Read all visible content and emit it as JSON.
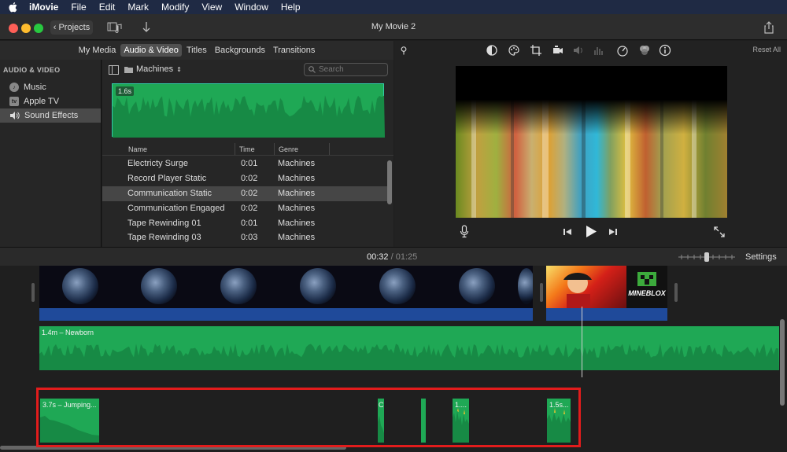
{
  "menubar": {
    "app": "iMovie",
    "items": [
      "File",
      "Edit",
      "Mark",
      "Modify",
      "View",
      "Window",
      "Help"
    ]
  },
  "window": {
    "title": "My Movie 2",
    "projects_label": "Projects"
  },
  "tabs": [
    {
      "label": "My Media",
      "active": false
    },
    {
      "label": "Audio & Video",
      "active": true
    },
    {
      "label": "Titles",
      "active": false
    },
    {
      "label": "Backgrounds",
      "active": false
    },
    {
      "label": "Transitions",
      "active": false
    }
  ],
  "sidebar": {
    "heading": "AUDIO & VIDEO",
    "items": [
      {
        "label": "Music",
        "icon": "music-icon",
        "selected": false
      },
      {
        "label": "Apple TV",
        "icon": "appletv-icon",
        "selected": false
      },
      {
        "label": "Sound Effects",
        "icon": "speaker-icon",
        "selected": true
      }
    ]
  },
  "browser": {
    "category": "Machines",
    "search_placeholder": "Search",
    "preview_duration": "1.6s",
    "columns": [
      "Name",
      "Time",
      "Genre"
    ],
    "rows": [
      {
        "name": "Electricty Surge",
        "time": "0:01",
        "genre": "Machines",
        "selected": false
      },
      {
        "name": "Record Player Static",
        "time": "0:02",
        "genre": "Machines",
        "selected": false
      },
      {
        "name": "Communication Static",
        "time": "0:02",
        "genre": "Machines",
        "selected": true
      },
      {
        "name": "Communication Engaged",
        "time": "0:02",
        "genre": "Machines",
        "selected": false
      },
      {
        "name": "Tape Rewinding 01",
        "time": "0:01",
        "genre": "Machines",
        "selected": false
      },
      {
        "name": "Tape Rewinding 03",
        "time": "0:03",
        "genre": "Machines",
        "selected": false
      }
    ]
  },
  "viewer": {
    "reset_label": "Reset All"
  },
  "timeline": {
    "current_time": "00:32",
    "separator": "/",
    "total_time": "01:25",
    "settings_label": "Settings",
    "music_clip_label": "1.4m – Newborn",
    "sfx_clips": [
      {
        "label": "3.7s – Jumping..."
      },
      {
        "label": "C"
      },
      {
        "label": ""
      },
      {
        "label": "1...."
      },
      {
        "label": "1.5s..."
      }
    ],
    "title_clip_text": "MINEBLOX"
  },
  "colors": {
    "audio_green": "#1fa855",
    "highlight_red": "#e21c1c",
    "menubar": "#1f2a44"
  }
}
